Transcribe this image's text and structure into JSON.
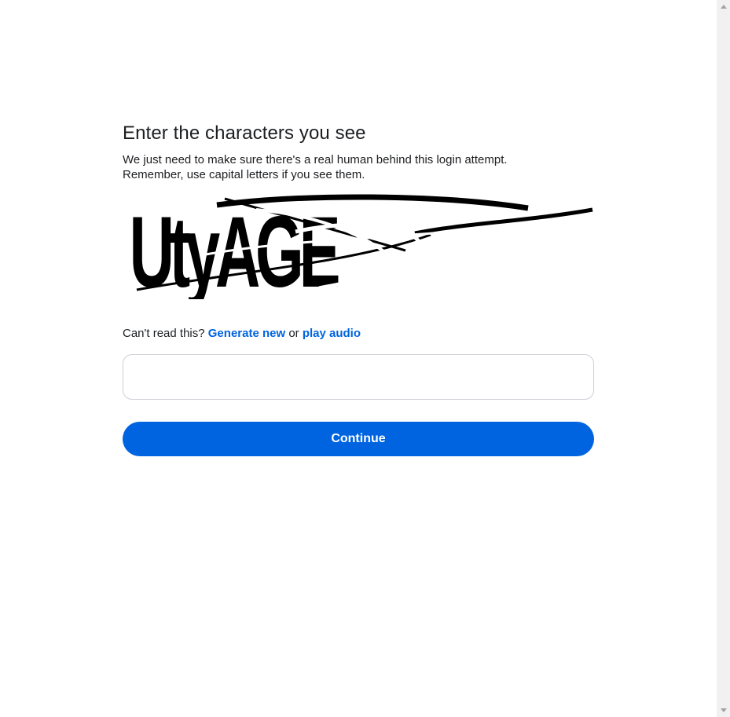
{
  "captcha_page": {
    "title": "Enter the characters you see",
    "description_line1": "We just need to make sure there's a real human behind this login attempt.",
    "description_line2": "Remember, use capital letters if you see them.",
    "captcha_text": "UtyAGE",
    "alt_prefix": "Can't read this?",
    "generate_new_label": "Generate new",
    "alt_or": "or",
    "play_audio_label": "play audio",
    "input_value": "",
    "input_placeholder": "",
    "continue_label": "Continue"
  },
  "colors": {
    "accent": "#0064e0",
    "text": "#1c1e21",
    "input_border": "#ccd0d5",
    "scrollbar_track": "#f1f1f1"
  },
  "icons": {
    "scroll_up": "scroll-up-arrow-icon",
    "scroll_down": "scroll-down-arrow-icon"
  }
}
